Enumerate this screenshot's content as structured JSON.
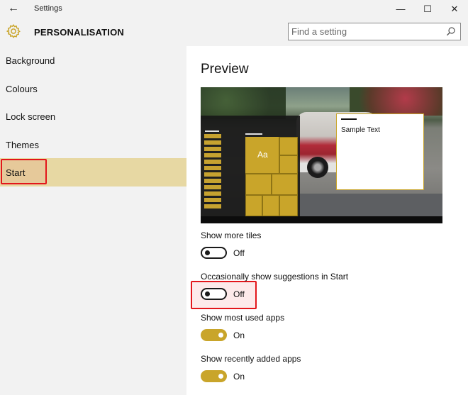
{
  "window": {
    "title": "Settings",
    "back_icon": "←",
    "min_icon": "—",
    "max_icon": "☐",
    "close_icon": "✕"
  },
  "header": {
    "section_title": "PERSONALISATION",
    "search_placeholder": "Find a setting"
  },
  "sidebar": {
    "items": [
      {
        "label": "Background"
      },
      {
        "label": "Colours"
      },
      {
        "label": "Lock screen"
      },
      {
        "label": "Themes"
      },
      {
        "label": "Start",
        "selected": true
      }
    ]
  },
  "main": {
    "preview_title": "Preview",
    "preview_tile_text": "Aa",
    "preview_sample_text": "Sample Text",
    "settings": [
      {
        "label": "Show more tiles",
        "state": "Off",
        "on": false
      },
      {
        "label": "Occasionally show suggestions in Start",
        "state": "Off",
        "on": false
      },
      {
        "label": "Show most used apps",
        "state": "On",
        "on": true
      },
      {
        "label": "Show recently added apps",
        "state": "On",
        "on": true
      }
    ]
  },
  "colors": {
    "accent": "#c9a52a",
    "selection": "#e7d8a3",
    "highlight_border": "#e3161b"
  }
}
